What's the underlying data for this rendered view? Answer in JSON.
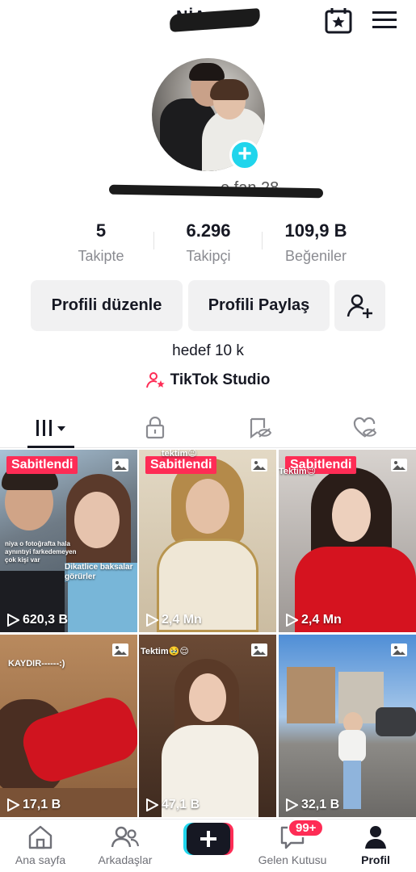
{
  "header": {
    "nickname": "NİA",
    "calendar_icon": "calendar-star-icon",
    "menu_icon": "hamburger-menu-icon"
  },
  "profile": {
    "handle_visible": "e fan 28",
    "stats": [
      {
        "value": "5",
        "label": "Takipte"
      },
      {
        "value": "6.296",
        "label": "Takipçi"
      },
      {
        "value": "109,9 B",
        "label": "Beğeniler"
      }
    ],
    "buttons": {
      "edit": "Profili düzenle",
      "share": "Profili Paylaş"
    },
    "bio": "hedef 10 k",
    "studio_label": "TikTok Studio"
  },
  "tabs": [
    "videos-grid",
    "private-lock",
    "reposts",
    "liked-hearts"
  ],
  "grid": [
    {
      "pinned": "Sabitlendi",
      "views": "620,3 B",
      "caption1": "niya o fotoğrafta hala aynıntıyi farkedemeyen çok kişi var",
      "caption2": "Dikatlice baksalar görürler"
    },
    {
      "pinned": "Sabitlendi",
      "views": "2,4 Mn",
      "caption1": "tektim😉"
    },
    {
      "pinned": "Sabitlendi",
      "views": "2,4 Mn",
      "caption1": "Tektim😉"
    },
    {
      "views": "17,1 B",
      "caption1": "KAYDIR------:)"
    },
    {
      "views": "47,1 B",
      "caption1": "Tektim🥹😌"
    },
    {
      "views": "32,1 B"
    }
  ],
  "bottom_nav": {
    "home": "Ana sayfa",
    "friends": "Arkadaşlar",
    "inbox": "Gelen Kutusu",
    "inbox_badge": "99+",
    "profile": "Profil"
  },
  "colors": {
    "accent_red": "#fe2c55",
    "accent_cyan": "#20d5ec",
    "text_primary": "#161823",
    "text_secondary": "#8a8b91"
  }
}
